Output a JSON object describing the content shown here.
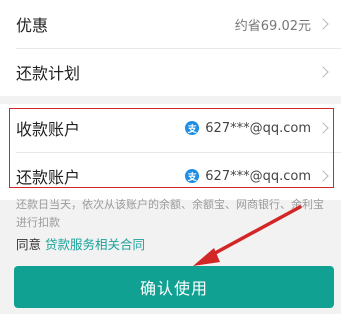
{
  "discount": {
    "label": "优惠",
    "value": "约省69.02元"
  },
  "plan": {
    "label": "还款计划"
  },
  "receive_account": {
    "label": "收款账户",
    "icon_char": "支",
    "account": "627***@qq.com"
  },
  "repay_account": {
    "label": "还款账户",
    "icon_char": "支",
    "account": "627***@qq.com"
  },
  "note": "还款日当天，依次从该账户的余额、余额宝、网商银行、余利宝进行扣款",
  "agree": {
    "prefix": "同意",
    "link": "贷款服务相关合同"
  },
  "confirm_button": "确认使用",
  "colors": {
    "accent": "#10a193",
    "highlight_box": "#d32626",
    "link": "#1ba29a",
    "alipay": "#1d8ee6"
  }
}
